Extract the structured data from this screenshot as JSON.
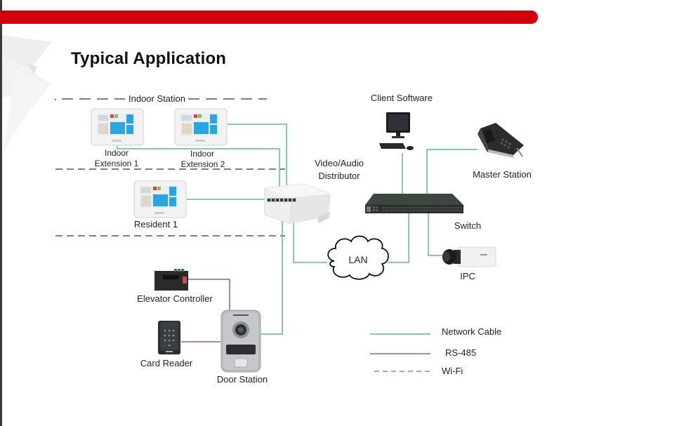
{
  "page": {
    "title": "Typical Application",
    "accent_color": "#d0000d"
  },
  "zones": {
    "indoor_station_label": "Indoor Station"
  },
  "devices": {
    "indoor_extension_1": {
      "label_line1": "Indoor",
      "label_line2": "Extension 1",
      "icon": "indoor-monitor-icon"
    },
    "indoor_extension_2": {
      "label_line1": "Indoor",
      "label_line2": "Extension 2",
      "icon": "indoor-monitor-icon"
    },
    "resident_1": {
      "label": "Resident 1",
      "icon": "indoor-monitor-icon"
    },
    "distributor": {
      "label_line1": "Video/Audio",
      "label_line2": "Distributor",
      "icon": "distributor-box-icon"
    },
    "client_software": {
      "label": "Client Software",
      "icon": "desktop-computer-icon"
    },
    "master_station": {
      "label": "Master Station",
      "icon": "master-station-icon"
    },
    "switch": {
      "label": "Switch",
      "icon": "network-switch-icon"
    },
    "lan": {
      "label": "LAN",
      "icon": "cloud-icon"
    },
    "ipc": {
      "label": "IPC",
      "icon": "box-camera-icon"
    },
    "elevator_controller": {
      "label": "Elevator Controller",
      "icon": "controller-board-icon"
    },
    "card_reader": {
      "label": "Card Reader",
      "icon": "keypad-reader-icon"
    },
    "door_station": {
      "label": "Door Station",
      "icon": "door-station-icon"
    }
  },
  "legend": {
    "items": [
      {
        "label": "Network Cable",
        "style": "solid",
        "color": "#5fba9a"
      },
      {
        "label": "RS-485",
        "style": "solid",
        "color": "#7b3f86"
      },
      {
        "label": "Wi-Fi",
        "style": "dashed",
        "color": "#4a7fc0"
      }
    ]
  }
}
